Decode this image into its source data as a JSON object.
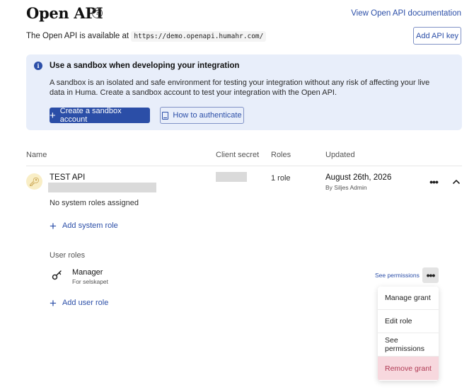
{
  "header": {
    "title": "Open API",
    "help_icon": "question-circle-icon",
    "doc_link": "View Open API documentation"
  },
  "availability": {
    "prefix": "The Open API is available at",
    "url": "https://demo.openapi.humahr.com/"
  },
  "add_key_label": "Add API key",
  "banner": {
    "icon": "info-icon",
    "title": "Use a sandbox when developing your integration",
    "text": "A sandbox is an isolated and safe environment for testing your integration without any risk of affecting your live data in Huma. Create a sandbox account to test your integration with the Open API.",
    "primary_button": "Create a sandbox account",
    "secondary_button": "How to authenticate"
  },
  "table": {
    "columns": [
      "Name",
      "Client secret",
      "Roles",
      "Updated"
    ]
  },
  "api": {
    "icon": "key-icon",
    "name": "TEST API",
    "roles": "1 role",
    "updated_date": "August 26th, 2026",
    "updated_by": "By Siljes Admin"
  },
  "system_roles": {
    "empty_text": "No system roles assigned",
    "add_label": "Add system role"
  },
  "user_roles": {
    "label": "User roles",
    "items": [
      {
        "name": "Manager",
        "subtitle": "For selskapet",
        "see_permissions": "See permissions"
      }
    ],
    "add_label": "Add user role"
  },
  "context_menu": {
    "items": [
      "Manage grant",
      "Edit role",
      "See permissions",
      "Remove grant"
    ]
  },
  "colors": {
    "accent": "#2b4ea7",
    "banner_bg": "#e8eefa",
    "danger": "#b03a54",
    "danger_bg": "#f7d8de"
  }
}
